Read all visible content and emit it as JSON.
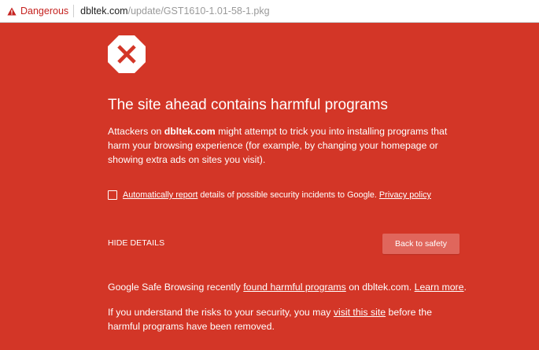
{
  "address_bar": {
    "security_label": "Dangerous",
    "security_icon": "warning-triangle-icon",
    "url_host": "dbltek.com",
    "url_path": "/update/GST1610-1.01-58-1.pkg"
  },
  "interstitial": {
    "icon": "red-octagon-x-icon",
    "title": "The site ahead contains harmful programs",
    "description": {
      "prefix": "Attackers on ",
      "site": "dbltek.com",
      "suffix": " might attempt to trick you into installing programs that harm your browsing experience (for example, by changing your homepage or showing extra ads on sites you visit)."
    },
    "report": {
      "checked": false,
      "link_text": "Automatically report",
      "text": " details of possible security incidents to Google. ",
      "privacy_link": "Privacy policy"
    },
    "hide_details_label": "HIDE DETAILS",
    "back_button_label": "Back to safety",
    "details": {
      "line1_prefix": "Google Safe Browsing recently ",
      "line1_link": "found harmful programs",
      "line1_middle": " on dbltek.com. ",
      "line1_link2": "Learn more",
      "line1_suffix": ".",
      "line2_prefix": "If you understand the risks to your security, you may ",
      "line2_link": "visit this site",
      "line2_suffix": " before the harmful programs have been removed."
    },
    "colors": {
      "background": "#d33627",
      "button": "#e0665c",
      "text": "#ffffff",
      "danger_chip": "#c5221f"
    }
  }
}
